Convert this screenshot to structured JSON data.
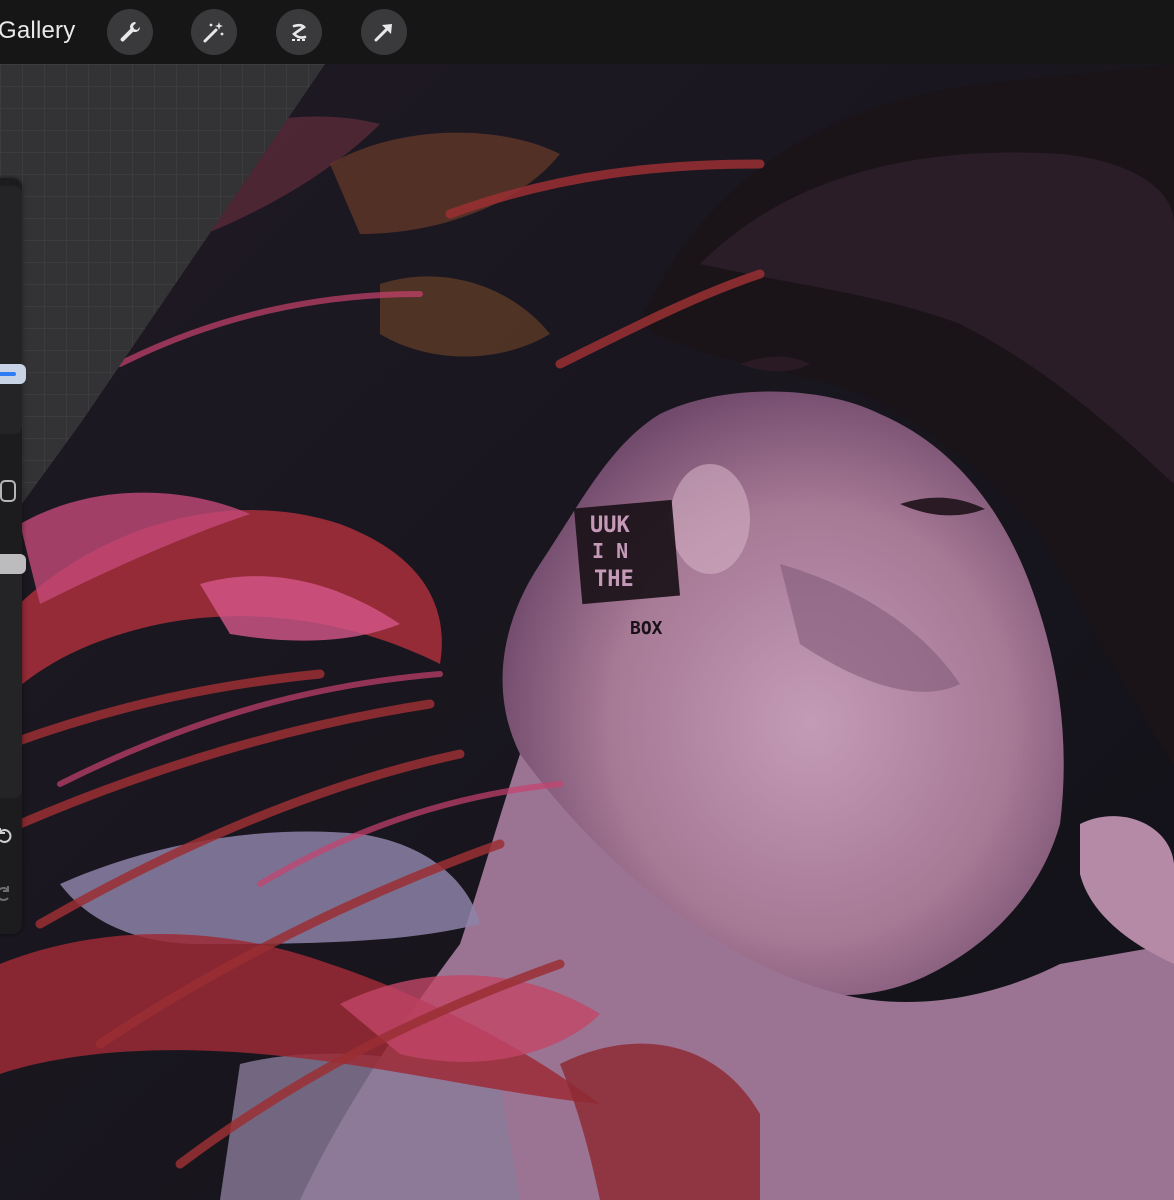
{
  "toolbar": {
    "gallery_label": "Gallery",
    "tools": [
      "wrench-icon",
      "magic-wand-icon",
      "selection-icon",
      "transform-arrow-icon"
    ]
  },
  "artwork": {
    "box_text": [
      "UUK",
      "I N",
      "THE",
      "BOX"
    ]
  },
  "colors": {
    "toolbar_bg": "#161617",
    "accent": "#2f7cf6",
    "skin": "#b58aa6",
    "petal_red": "#a22e3a"
  }
}
